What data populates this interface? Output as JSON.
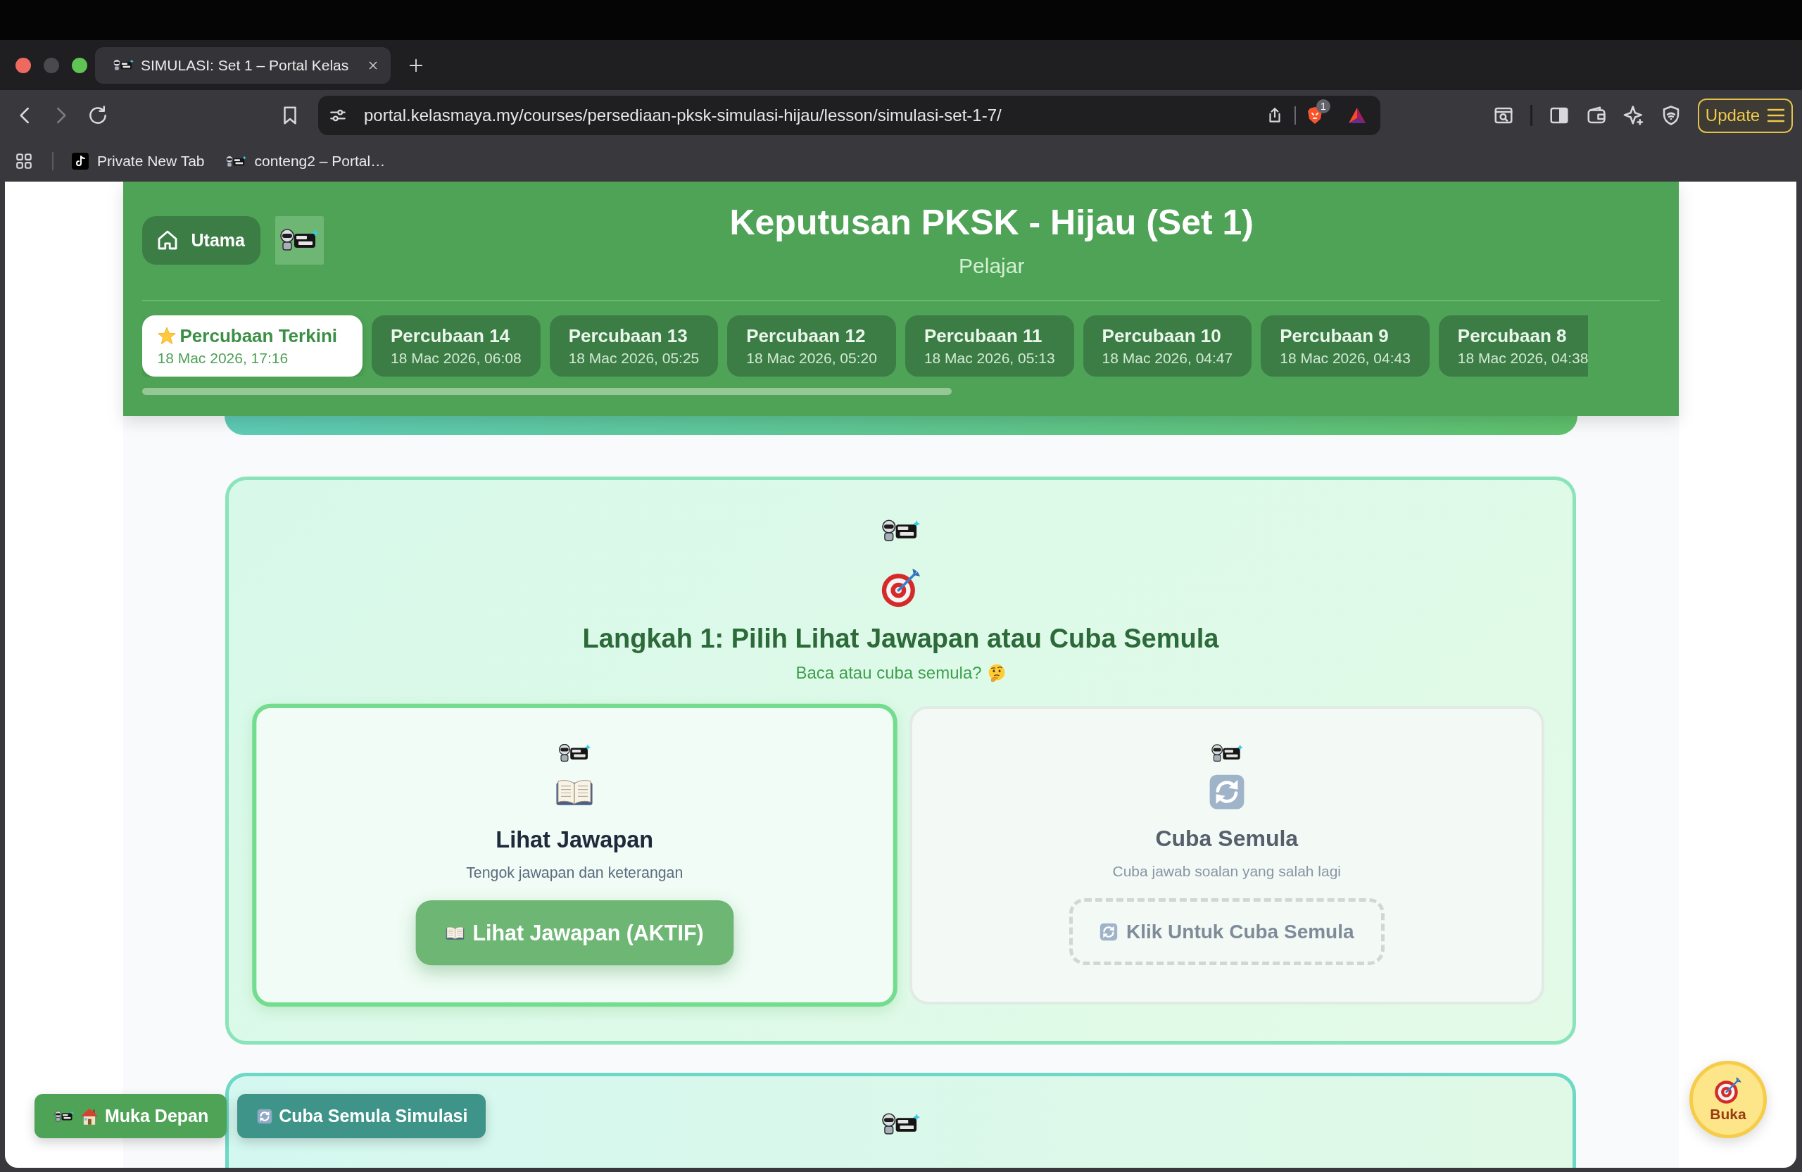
{
  "browser": {
    "tab_title": "SIMULASI: Set 1 – Portal Kelas",
    "address": "portal.kelasmaya.my/courses/persediaan-pksk-simulasi-hijau/lesson/simulasi-set-1-7/",
    "shields_badge": "1",
    "update_button": "Update",
    "bookmarks": [
      {
        "kind": "tiktok",
        "label": "Private New Tab"
      },
      {
        "kind": "site",
        "label": "conteng2 – Portal…"
      }
    ]
  },
  "header": {
    "home_button": "Utama",
    "title": "Keputusan PKSK - Hijau (Set 1)",
    "subtitle": "Pelajar",
    "attempts": [
      {
        "kind": "latest",
        "label": "Percubaan Terkini",
        "date": "18 Mac 2026, 17:16",
        "selected": true
      },
      {
        "kind": "past",
        "label": "Percubaan 14",
        "date": "18 Mac 2026, 06:08",
        "selected": false
      },
      {
        "kind": "past",
        "label": "Percubaan 13",
        "date": "18 Mac 2026, 05:25",
        "selected": false
      },
      {
        "kind": "past",
        "label": "Percubaan 12",
        "date": "18 Mac 2026, 05:20",
        "selected": false
      },
      {
        "kind": "past",
        "label": "Percubaan 11",
        "date": "18 Mac 2026, 05:13",
        "selected": false
      },
      {
        "kind": "past",
        "label": "Percubaan 10",
        "date": "18 Mac 2026, 04:47",
        "selected": false
      },
      {
        "kind": "past",
        "label": "Percubaan 9",
        "date": "18 Mac 2026, 04:43",
        "selected": false
      },
      {
        "kind": "past",
        "label": "Percubaan 8",
        "date": "18 Mac 2026, 04:38",
        "selected": false
      }
    ]
  },
  "step_card": {
    "title": "Langkah 1: Pilih Lihat Jawapan atau Cuba Semula",
    "subtitle": "Baca atau cuba semula?",
    "options": [
      {
        "kind": "review",
        "title": "Lihat Jawapan",
        "description": "Tengok jawapan dan keterangan",
        "button": "Lihat Jawapan (AKTIF)",
        "selected": true
      },
      {
        "kind": "retry",
        "title": "Cuba Semula",
        "description": "Cuba jawab soalan yang salah lagi",
        "button": "Klik Untuk Cuba Semula",
        "selected": false
      }
    ]
  },
  "floating_buttons": [
    {
      "kind": "home",
      "label": "Muka Depan"
    },
    {
      "kind": "retry",
      "label": "Cuba Semula Simulasi"
    }
  ],
  "fab": {
    "label": "Buka"
  }
}
